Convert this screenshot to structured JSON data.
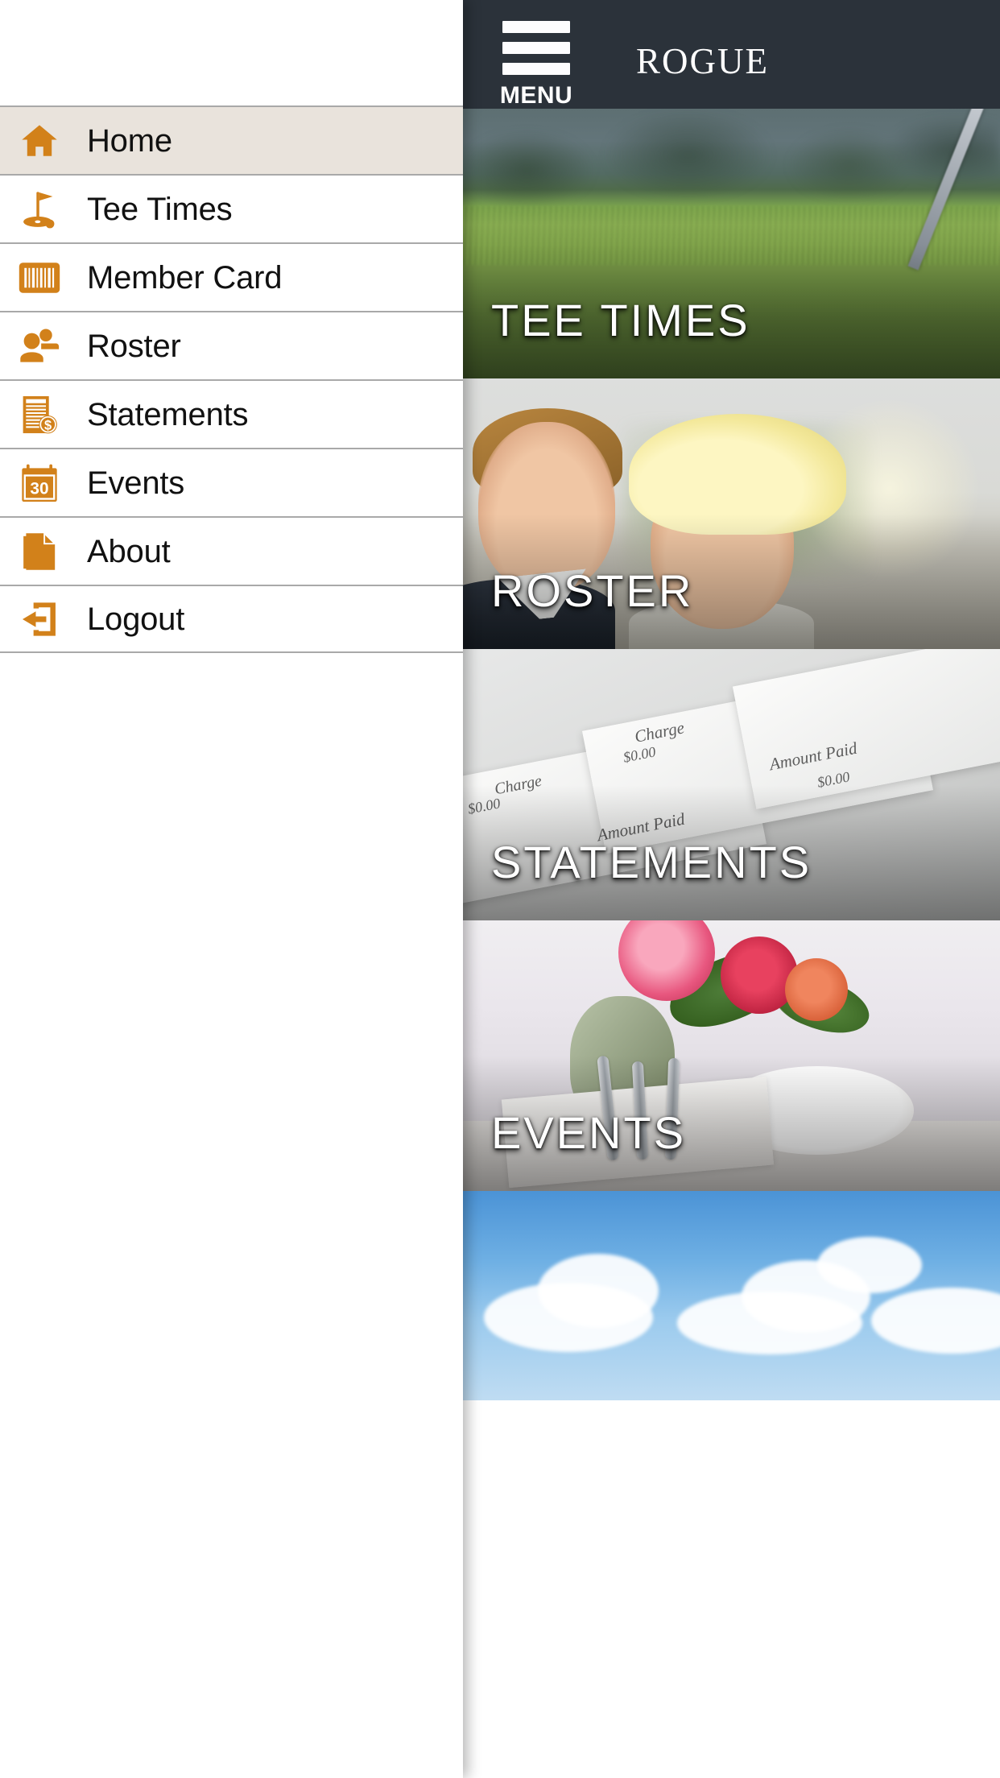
{
  "header": {
    "menu_button_label": "MENU",
    "hamburger_icon": "hamburger-menu-icon",
    "title": "ROGUE",
    "background_color": "#2B323A",
    "text_color": "#FFFFFF"
  },
  "drawer": {
    "accent_color": "#D2811A",
    "active_row_color": "#E9E3DC",
    "divider_color": "#A9A9A9",
    "items": [
      {
        "label": "Home",
        "icon": "home-icon",
        "active": true
      },
      {
        "label": "Tee Times",
        "icon": "golf-flag-icon",
        "active": false
      },
      {
        "label": "Member Card",
        "icon": "barcode-icon",
        "active": false
      },
      {
        "label": "Roster",
        "icon": "people-icon",
        "active": false
      },
      {
        "label": "Statements",
        "icon": "invoice-dollar-icon",
        "active": false
      },
      {
        "label": "Events",
        "icon": "calendar-30-icon",
        "active": false
      },
      {
        "label": "About",
        "icon": "document-icon",
        "active": false
      },
      {
        "label": "Logout",
        "icon": "exit-arrow-icon",
        "active": false
      }
    ]
  },
  "content": {
    "cards": [
      {
        "label": "TEE TIMES",
        "photo": "golf-course-photo"
      },
      {
        "label": "ROSTER",
        "photo": "smiling-couple-photo"
      },
      {
        "label": "STATEMENTS",
        "photo": "paper-statements-photo"
      },
      {
        "label": "EVENTS",
        "photo": "banquet-table-photo"
      },
      {
        "label": "",
        "photo": "sky-clouds-photo"
      }
    ],
    "card_label_color": "#FFFFFF"
  },
  "statement_photo_text": [
    "Charge",
    "$0.00",
    "Amount Paid",
    "Charge",
    "$0.00",
    "Amount Paid",
    "$0.00"
  ]
}
